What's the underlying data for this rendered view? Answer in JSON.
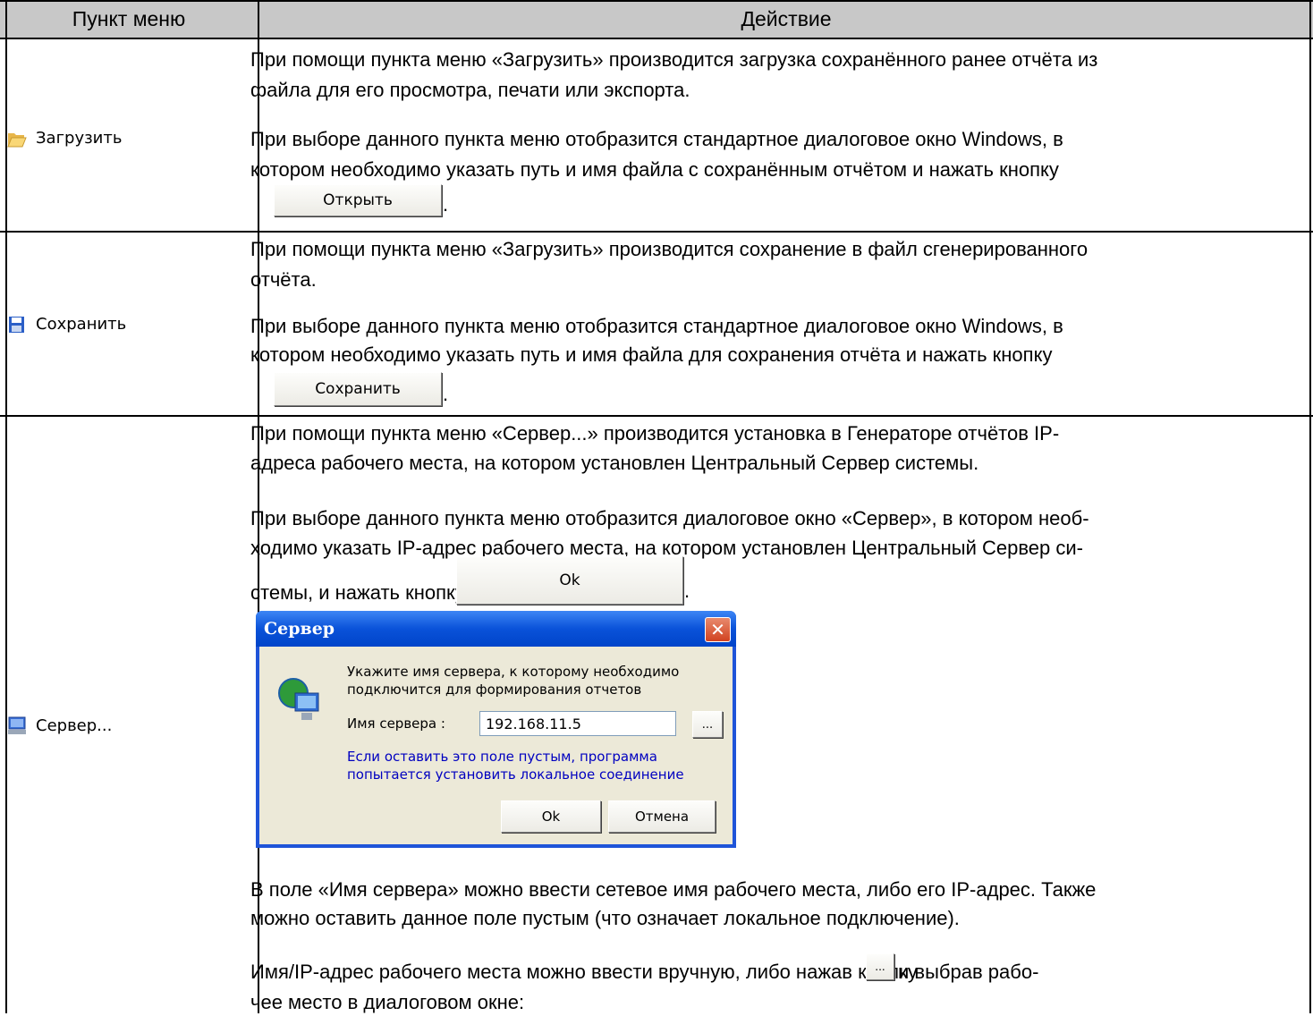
{
  "header": {
    "col1": "Пункт меню",
    "col2": "Действие"
  },
  "rows": [
    {
      "menu_label": "Загрузить",
      "icon": "folder-open-icon",
      "lines_a": [
        "При помощи пункта меню «Загрузить» производится загрузка сохранённого ранее отчёта из",
        " файла для его просмотра, печати или экспорта."
      ],
      "lines_b": [
        "При выборе данного пункта меню отобразится стандартное диалоговое окно Windows, в",
        " котором необходимо указать путь и имя файла с сохранённым отчётом и нажать кнопку"
      ],
      "button": "Открыть"
    },
    {
      "menu_label": "Сохранить",
      "icon": "floppy-disk-icon",
      "lines_a": [
        "При помощи пункта меню «Загрузить» производится сохранение в файл сгенерированного",
        " отчёта."
      ],
      "lines_b": [
        "При выборе данного пункта меню отобразится стандартное диалоговое окно Windows, в",
        " котором необходимо указать путь и имя файла для сохранения отчёта и нажать кнопку"
      ],
      "button": "Сохранить"
    },
    {
      "menu_label": "Сервер...",
      "icon": "computer-icon",
      "lines_a": [
        "При помощи пункта меню «Сервер...» производится установка в Генераторе отчётов IP-",
        " адреса рабочего места, на котором установлен Центральный Сервер системы."
      ],
      "lines_b": [
        "При выборе данного пункта меню отобразится диалоговое окно «Сервер», в котором необ-",
        " ходимо указать IP-адрес рабочего места, на котором установлен Центральный Сервер си-"
      ],
      "line_c": " стемы, и нажать кнопку",
      "button": "Ok",
      "lines_d": [
        "В поле «Имя сервера» можно ввести сетевое имя рабочего места, либо его IP-адрес. Также",
        " можно оставить данное поле пустым (что означает локальное подключение)."
      ],
      "line_e1": "Имя/IP-адрес рабочего места можно ввести вручную, либо нажав кнопку",
      "line_e2": "и выбрав рабо-",
      "line_f": " чее место в диалоговом окне:"
    }
  ],
  "dialog": {
    "title": "Сервер",
    "message": [
      "Укажите имя сервера, к которому необходимо",
      "подключится для формирования отчетов"
    ],
    "field_label": "Имя сервера :",
    "field_value": "192.168.11.5",
    "browse": "...",
    "hint": [
      "Если оставить это поле пустым, программа",
      "попытается установить локальное соединение"
    ],
    "ok": "Ok",
    "cancel": "Отмена",
    "hint_color": "#0000c0"
  }
}
